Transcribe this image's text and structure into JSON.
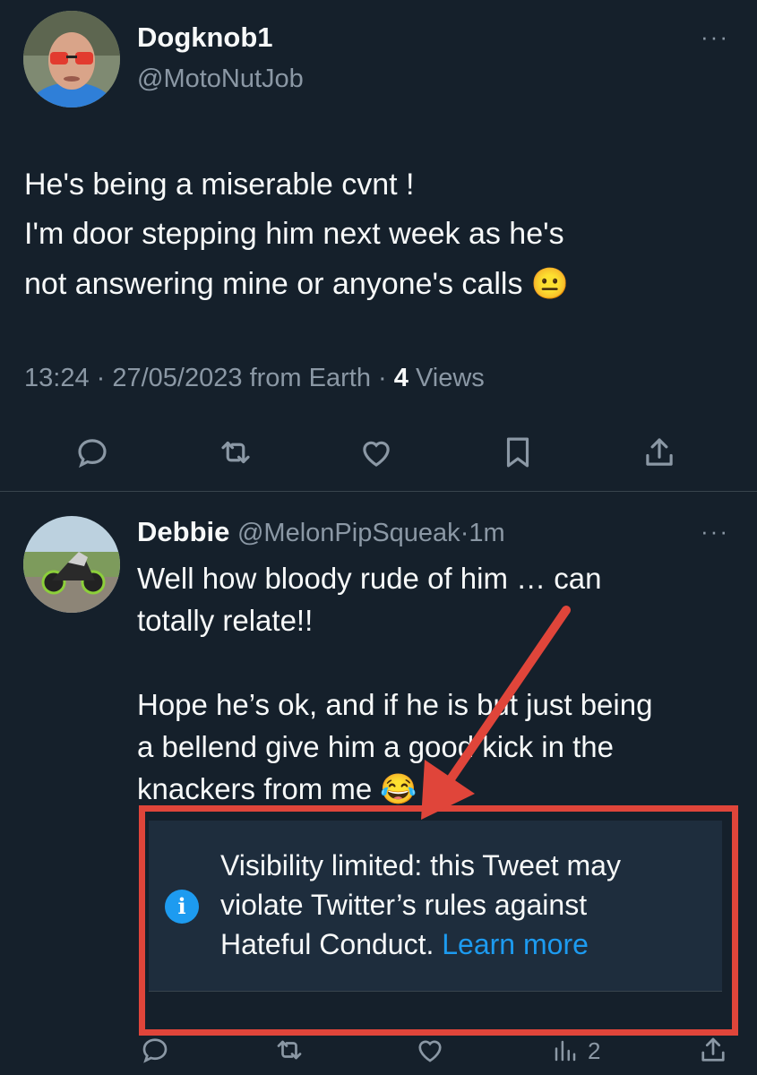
{
  "tweet": {
    "display_name": "Dogknob1",
    "handle": "@MotoNutJob",
    "text_lines": [
      "He's being a miserable cvnt !",
      "I'm door stepping him next week as he's",
      "not answering mine or anyone's calls 😐"
    ],
    "time": "13:24",
    "date": "27/05/2023",
    "source": "from Earth",
    "views_count": "4",
    "views_label": "Views",
    "more": "···"
  },
  "reply": {
    "display_name": "Debbie",
    "handle": "@MelonPipSqueak",
    "separator": "·",
    "time": "1m",
    "more": "···",
    "text_lines": [
      "Well how bloody rude of him … can",
      "totally relate!!",
      "",
      "Hope he’s ok, and if he is but just being",
      "a bellend give him a good kick in the",
      "knackers from me 😂"
    ],
    "notice": {
      "line1": "Visibility limited: this Tweet may",
      "line2": "violate Twitter’s rules against",
      "line3": "Hateful Conduct.",
      "link": "Learn more",
      "icon": "info-icon"
    },
    "views_count": "2"
  },
  "colors": {
    "background": "#15202b",
    "text": "#f7f9f9",
    "muted": "#8b98a5",
    "link": "#1d9bf0",
    "annotation": "#e0453a",
    "notice_bg": "#1e2d3d"
  }
}
